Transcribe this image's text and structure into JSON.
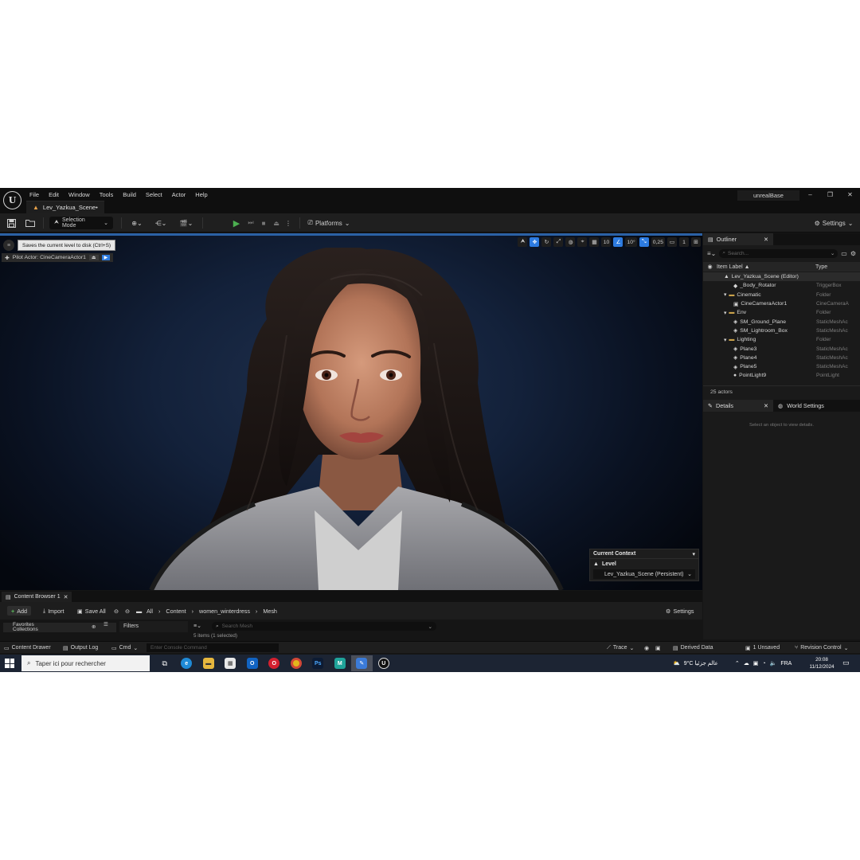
{
  "window": {
    "project_name": "unrealBase",
    "document_tab": "Lev_Yazkua_Scene•",
    "controls": [
      "–",
      "❐",
      "✕"
    ]
  },
  "menu": [
    "File",
    "Edit",
    "Window",
    "Tools",
    "Build",
    "Select",
    "Actor",
    "Help"
  ],
  "toolbar": {
    "selection_mode": "Selection Mode",
    "platforms": "Platforms",
    "settings": "Settings",
    "tooltip": "Saves the current level to disk (Ctrl+S)"
  },
  "viewport": {
    "pilot_actor": "Pilot Actor: CineCameraActor1",
    "grid_snap": "10",
    "rotation_snap": "10°",
    "scale_snap": "0,25",
    "camera_speed": "1",
    "current_context": {
      "title": "Current Context",
      "level_label": "Level",
      "level_value": "Lev_Yazkua_Scene (Persistent)"
    }
  },
  "outliner": {
    "tab_label": "Outliner",
    "search_placeholder": "Search...",
    "col_label": "Item Label ▲",
    "col_type": "Type",
    "rows": [
      {
        "label": "Lev_Yazkua_Scene (Editor)",
        "type": "",
        "indent": 0,
        "kind": "level"
      },
      {
        "label": "_Body_Rotator",
        "type": "TriggerBox",
        "indent": 2,
        "kind": "actor"
      },
      {
        "label": "Cinematic",
        "type": "Folder",
        "indent": 1,
        "kind": "folder"
      },
      {
        "label": "CineCameraActor1",
        "type": "CineCameraA",
        "indent": 2,
        "kind": "camera"
      },
      {
        "label": "Env",
        "type": "Folder",
        "indent": 1,
        "kind": "folder"
      },
      {
        "label": "SM_Ground_Plane",
        "type": "StaticMeshAc",
        "indent": 2,
        "kind": "mesh"
      },
      {
        "label": "SM_Lightroom_Box",
        "type": "StaticMeshAc",
        "indent": 2,
        "kind": "mesh"
      },
      {
        "label": "Lighting",
        "type": "Folder",
        "indent": 1,
        "kind": "folder"
      },
      {
        "label": "Plane3",
        "type": "StaticMeshAc",
        "indent": 2,
        "kind": "mesh"
      },
      {
        "label": "Plane4",
        "type": "StaticMeshAc",
        "indent": 2,
        "kind": "mesh"
      },
      {
        "label": "Plane5",
        "type": "StaticMeshAc",
        "indent": 2,
        "kind": "mesh"
      },
      {
        "label": "PointLight9",
        "type": "PointLight",
        "indent": 2,
        "kind": "light"
      }
    ],
    "actor_count": "25 actors"
  },
  "details": {
    "tab_label": "Details",
    "world_settings": "World Settings",
    "empty_text": "Select an object to view details."
  },
  "content_browser": {
    "tab_label": "Content Browser 1",
    "add": "Add",
    "import": "Import",
    "save_all": "Save All",
    "breadcrumb": [
      "All",
      "Content",
      "women_winterdress",
      "Mesh"
    ],
    "settings": "Settings",
    "favorites": "Favorites",
    "collections": "Collections",
    "filters": "Filters",
    "search_placeholder": "Search Mesh",
    "item_count": "5 items (1 selected)"
  },
  "status_bar": {
    "content_drawer": "Content Drawer",
    "output_log": "Output Log",
    "cmd": "Cmd",
    "console_placeholder": "Enter Console Command",
    "trace": "Trace",
    "derived_data": "Derived Data",
    "unsaved": "1 Unsaved",
    "revision_control": "Revision Control"
  },
  "taskbar": {
    "search_placeholder": "Taper ici pour rechercher",
    "weather": "9°C عالم جزئيا",
    "language": "FRA",
    "time": "20:08",
    "date": "11/12/2024"
  },
  "colors": {
    "accent": "#2d7be0",
    "viewport_bg": "#13213a",
    "play": "#4caf50",
    "folder": "#c9a24b"
  }
}
